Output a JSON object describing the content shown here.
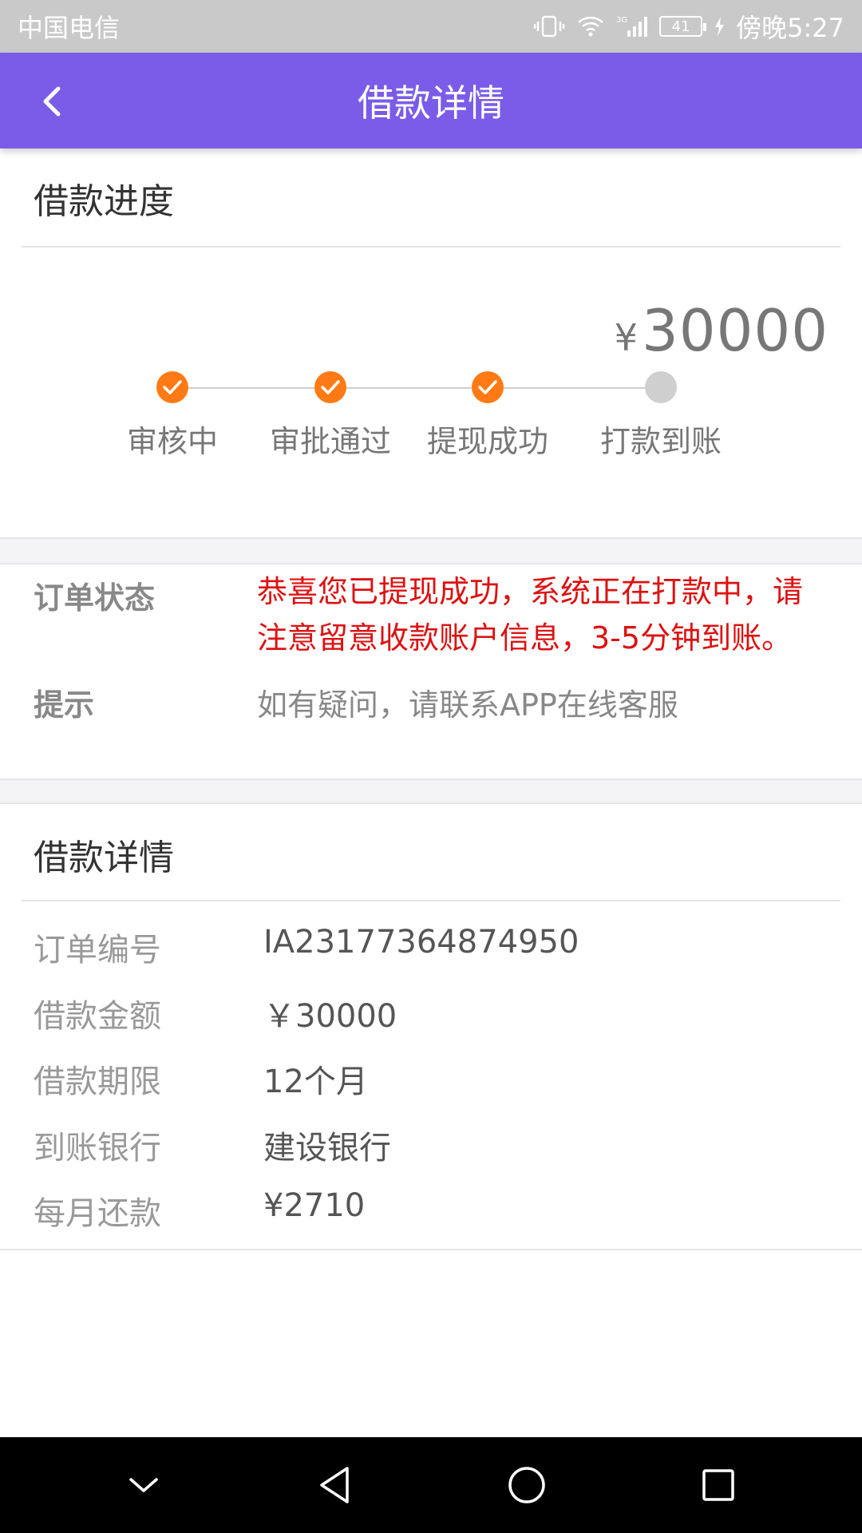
{
  "status_bar": {
    "carrier": "中国电信",
    "network": "3G",
    "battery": "41",
    "time": "傍晚5:27"
  },
  "header": {
    "title": "借款详情"
  },
  "progress": {
    "section_title": "借款进度",
    "amount_symbol": "¥",
    "amount": "30000",
    "steps": [
      {
        "label": "审核中",
        "done": true
      },
      {
        "label": "审批通过",
        "done": true
      },
      {
        "label": "提现成功",
        "done": true
      },
      {
        "label": "打款到账",
        "done": false
      }
    ]
  },
  "order_status": {
    "status_label": "订单状态",
    "status_text": "恭喜您已提现成功，系统正在打款中，请注意留意收款账户信息，3-5分钟到账。",
    "tip_label": "提示",
    "tip_text": "如有疑问，请联系APP在线客服"
  },
  "details": {
    "section_title": "借款详情",
    "rows": [
      {
        "label": "订单编号",
        "value": "IA23177364874950"
      },
      {
        "label": "借款金额",
        "value": "￥30000"
      },
      {
        "label": "借款期限",
        "value": "12个月"
      },
      {
        "label": "到账银行",
        "value": "建设银行"
      },
      {
        "label": "每月还款",
        "value": "¥2710"
      }
    ]
  },
  "colors": {
    "header": "#7a5ce8",
    "step_done": "#ff7a14",
    "step_todo": "#cfcfcf",
    "status_text": "#dd1111"
  },
  "icons": {
    "back": "chevron-left-icon",
    "nav": [
      "collapse-icon",
      "back-triangle-icon",
      "home-circle-icon",
      "recents-square-icon"
    ]
  }
}
